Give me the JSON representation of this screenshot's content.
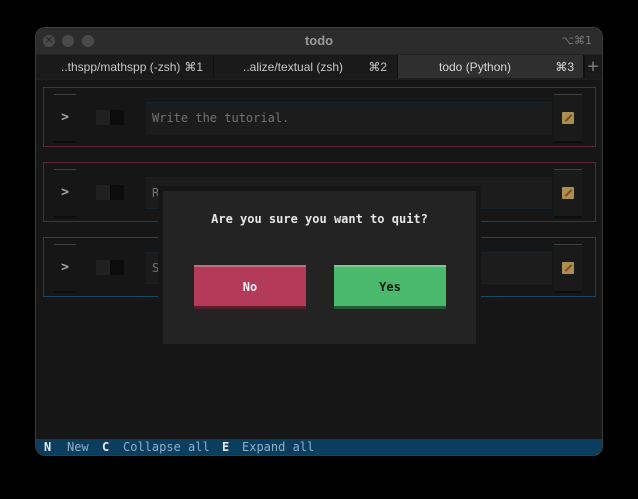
{
  "window": {
    "title": "todo",
    "shortcut": "⌥⌘1"
  },
  "tabs": [
    {
      "name": "..thspp/mathspp (-zsh)",
      "key": "⌘1"
    },
    {
      "name": "..alize/textual (zsh)",
      "key": "⌘2"
    },
    {
      "name": "todo (Python)",
      "key": "⌘3"
    }
  ],
  "tab_add": "+",
  "todos": [
    {
      "expand": ">",
      "description": "Write the tutorial."
    },
    {
      "expand": ">",
      "description": "R"
    },
    {
      "expand": ">",
      "description": "S"
    }
  ],
  "dialog": {
    "question": "Are you sure you want to quit?",
    "no_label": "No",
    "yes_label": "Yes"
  },
  "footer": {
    "bindings": [
      {
        "key": "N",
        "label": "New"
      },
      {
        "key": "C",
        "label": "Collapse all"
      },
      {
        "key": "E",
        "label": "Expand all"
      }
    ]
  },
  "colors": {
    "todo_border_red": "#7d3546",
    "todo_border_blue": "#1f5f8a",
    "no_button": "#b33a58",
    "yes_button": "#4bb96b",
    "footer_bg": "#0b3d5e"
  },
  "icons": {
    "edit": "pencil-icon"
  }
}
